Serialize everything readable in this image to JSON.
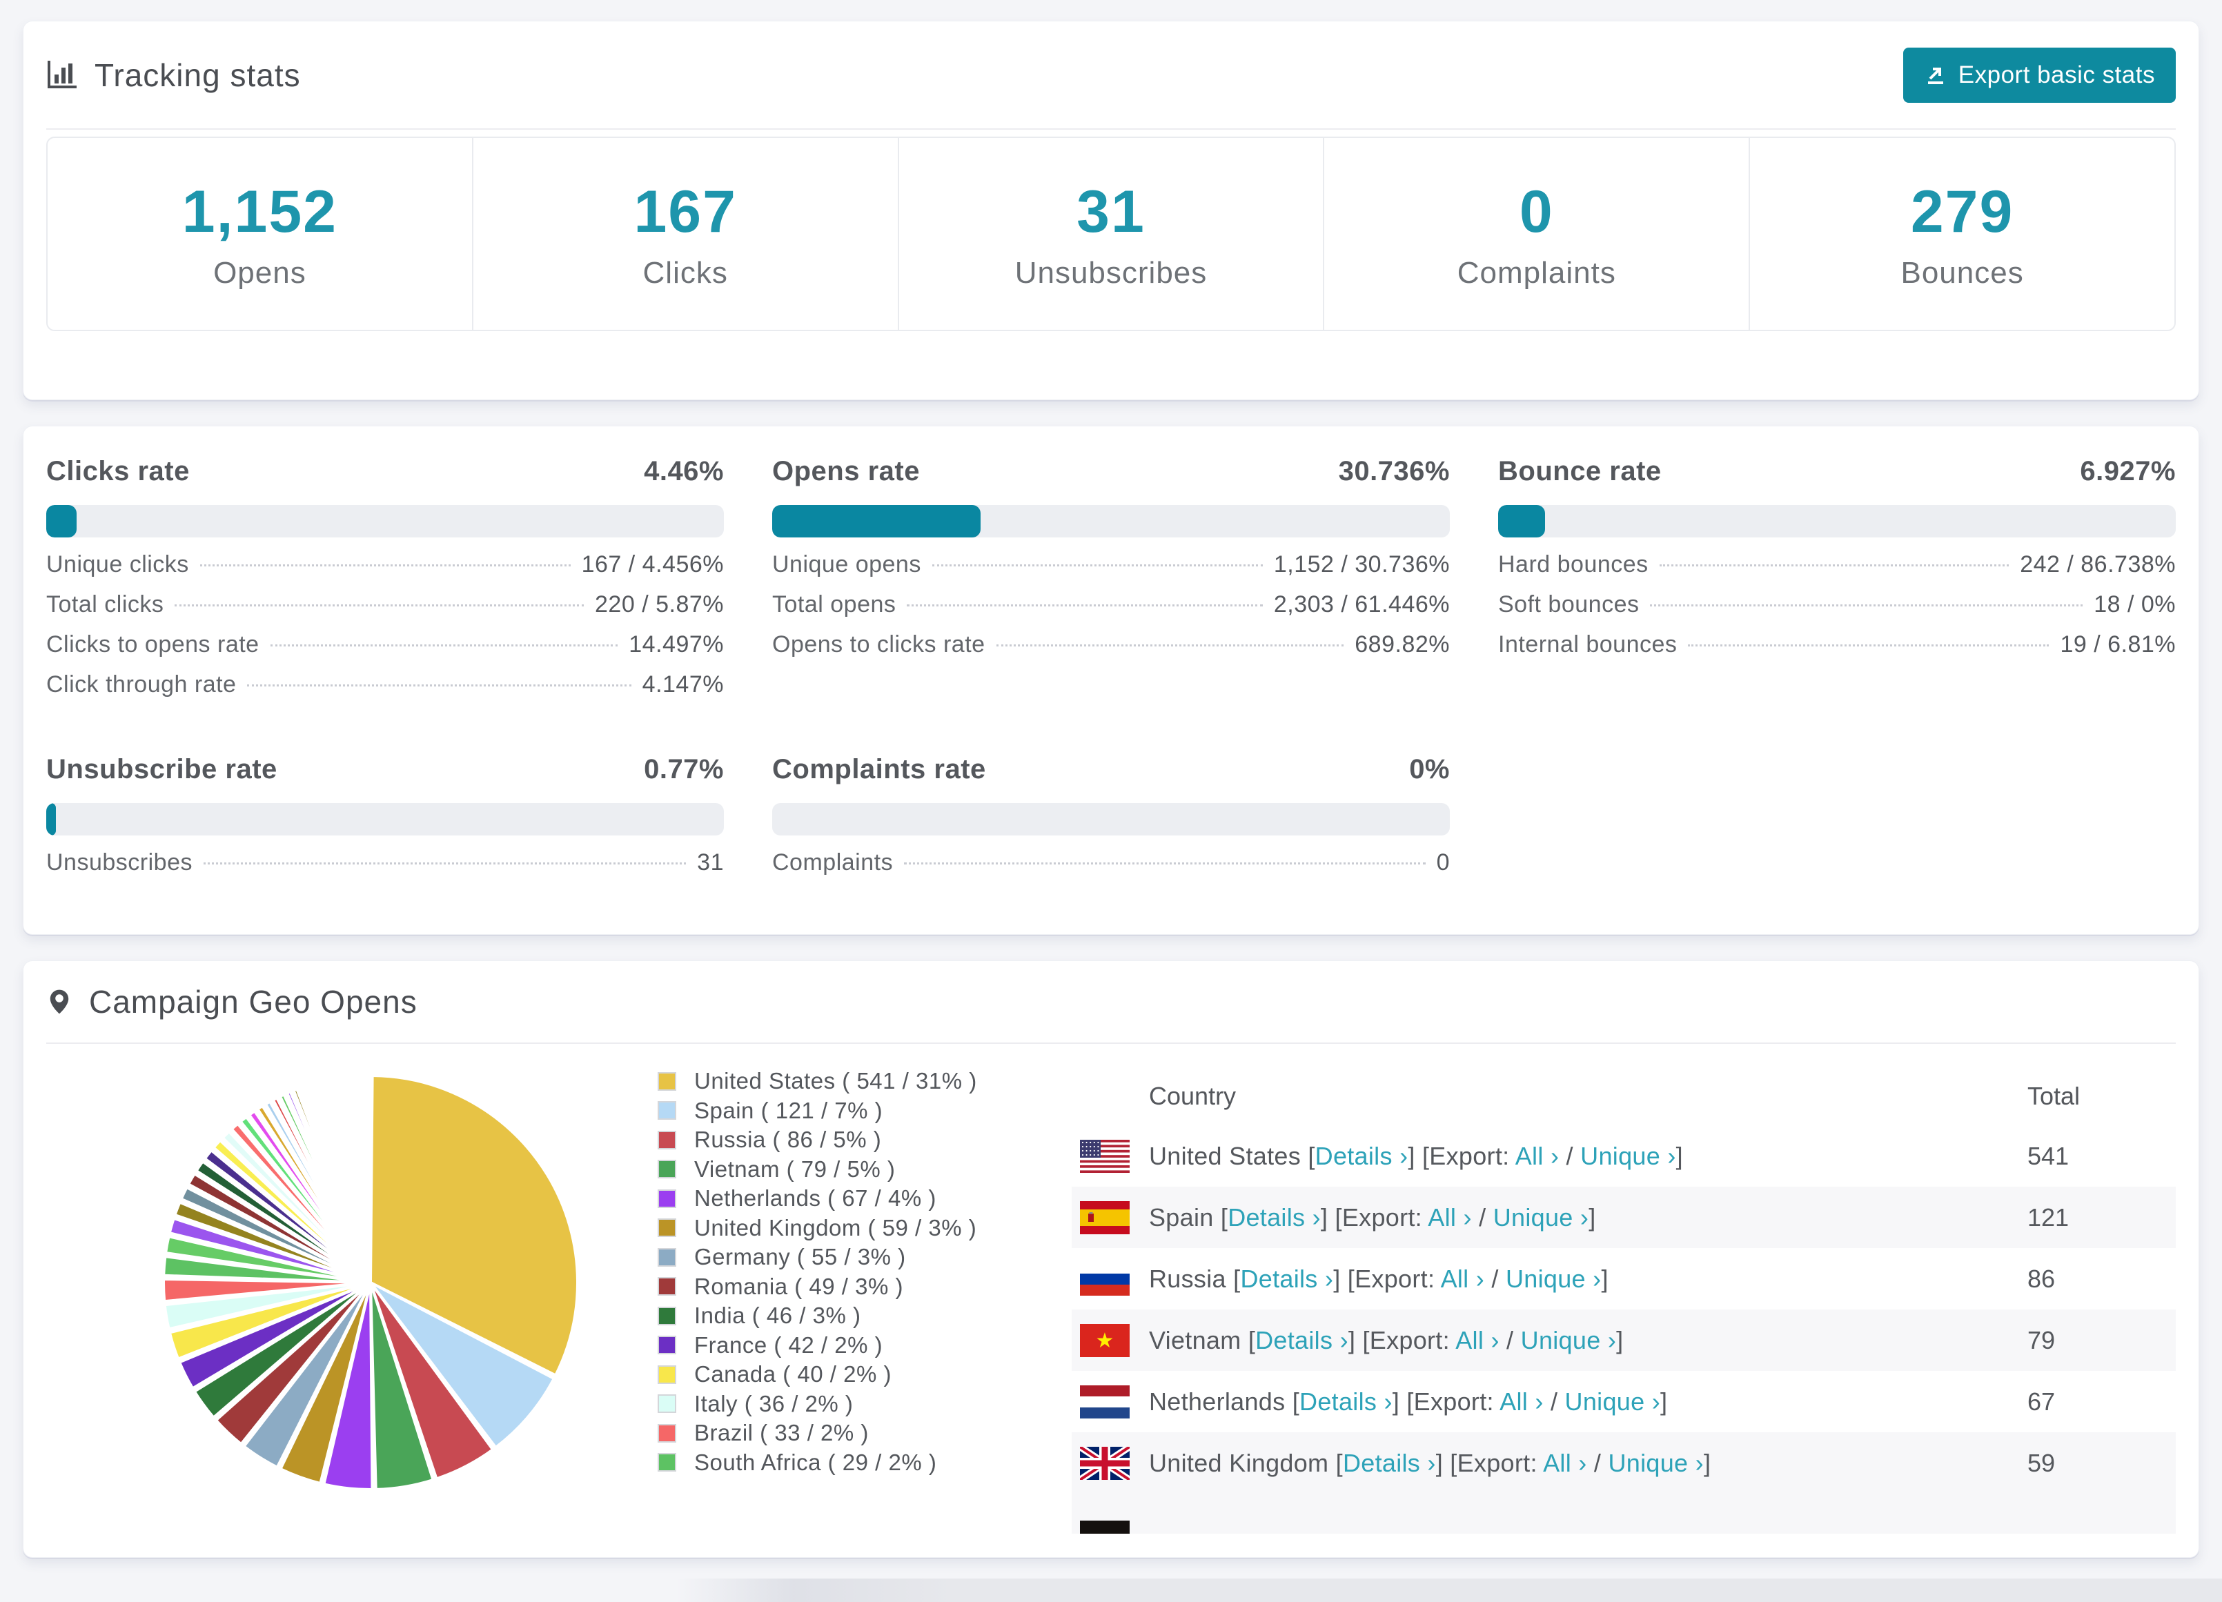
{
  "colors": {
    "accent_number": "#1e95ac",
    "button": "#0e8a9f",
    "progress_fill": "#0a87a1",
    "progress_track": "#eceef2",
    "link": "#2da2b8"
  },
  "tracking": {
    "title": "Tracking stats",
    "export_label": "Export basic stats",
    "stats": [
      {
        "value": "1,152",
        "label": "Opens"
      },
      {
        "value": "167",
        "label": "Clicks"
      },
      {
        "value": "31",
        "label": "Unsubscribes"
      },
      {
        "value": "0",
        "label": "Complaints"
      },
      {
        "value": "279",
        "label": "Bounces"
      }
    ]
  },
  "rates": [
    {
      "title": "Clicks rate",
      "value": "4.46%",
      "percent": 4.46,
      "rows": [
        {
          "label": "Unique clicks",
          "value": "167 / 4.456%"
        },
        {
          "label": "Total clicks",
          "value": "220 / 5.87%"
        },
        {
          "label": "Clicks to opens rate",
          "value": "14.497%"
        },
        {
          "label": "Click through rate",
          "value": "4.147%"
        }
      ]
    },
    {
      "title": "Opens rate",
      "value": "30.736%",
      "percent": 30.736,
      "rows": [
        {
          "label": "Unique opens",
          "value": "1,152 / 30.736%"
        },
        {
          "label": "Total opens",
          "value": "2,303 / 61.446%"
        },
        {
          "label": "Opens to clicks rate",
          "value": "689.82%"
        }
      ]
    },
    {
      "title": "Bounce rate",
      "value": "6.927%",
      "percent": 6.927,
      "rows": [
        {
          "label": "Hard bounces",
          "value": "242 / 86.738%"
        },
        {
          "label": "Soft bounces",
          "value": "18 / 0%"
        },
        {
          "label": "Internal bounces",
          "value": "19 / 6.81%"
        }
      ]
    },
    {
      "title": "Unsubscribe rate",
      "value": "0.77%",
      "percent": 0.77,
      "rows": [
        {
          "label": "Unsubscribes",
          "value": "31"
        }
      ]
    },
    {
      "title": "Complaints rate",
      "value": "0%",
      "percent": 0,
      "rows": [
        {
          "label": "Complaints",
          "value": "0"
        }
      ]
    }
  ],
  "geo": {
    "title": "Campaign Geo Opens",
    "legend": [
      {
        "label": "United States ( 541 / 31% )",
        "color": "#e7c345"
      },
      {
        "label": "Spain ( 121 / 7% )",
        "color": "#b5d9f5"
      },
      {
        "label": "Russia ( 86 / 5% )",
        "color": "#c84a52"
      },
      {
        "label": "Vietnam ( 79 / 5% )",
        "color": "#4aa558"
      },
      {
        "label": "Netherlands ( 67 / 4% )",
        "color": "#9b3ff0"
      },
      {
        "label": "United Kingdom ( 59 / 3% )",
        "color": "#bb9426"
      },
      {
        "label": "Germany ( 55 / 3% )",
        "color": "#8cabc4"
      },
      {
        "label": "Romania ( 49 / 3% )",
        "color": "#a03a3a"
      },
      {
        "label": "India ( 46 / 3% )",
        "color": "#2f7a3b"
      },
      {
        "label": "France ( 42 / 2% )",
        "color": "#6c2fc4"
      },
      {
        "label": "Canada ( 40 / 2% )",
        "color": "#f8e74b"
      },
      {
        "label": "Italy ( 36 / 2% )",
        "color": "#dafdf6"
      },
      {
        "label": "Brazil ( 33 / 2% )",
        "color": "#f56767"
      },
      {
        "label": "South Africa ( 29 / 2% )",
        "color": "#5dc263"
      }
    ],
    "table": {
      "columns": [
        "Country",
        "Total"
      ],
      "links": {
        "bracket_open": " [",
        "details": "Details ›",
        "export_open": "] [Export: ",
        "all": "All ›",
        "slash": " / ",
        "unique": "Unique ›",
        "bracket_close": "]"
      },
      "rows": [
        {
          "flag": "us",
          "name": "United States",
          "total": "541"
        },
        {
          "flag": "es",
          "name": "Spain",
          "total": "121"
        },
        {
          "flag": "ru",
          "name": "Russia",
          "total": "86"
        },
        {
          "flag": "vn",
          "name": "Vietnam",
          "total": "79"
        },
        {
          "flag": "nl",
          "name": "Netherlands",
          "total": "67"
        },
        {
          "flag": "gb",
          "name": "United Kingdom",
          "total": "59"
        }
      ]
    }
  },
  "chart_data": {
    "type": "pie",
    "title": "Campaign Geo Opens",
    "legend_position": "right",
    "series": [
      {
        "name": "United States",
        "value": 541,
        "pct": 31,
        "color": "#e7c345"
      },
      {
        "name": "Spain",
        "value": 121,
        "pct": 7,
        "color": "#b5d9f5"
      },
      {
        "name": "Russia",
        "value": 86,
        "pct": 5,
        "color": "#c84a52"
      },
      {
        "name": "Vietnam",
        "value": 79,
        "pct": 5,
        "color": "#4aa558"
      },
      {
        "name": "Netherlands",
        "value": 67,
        "pct": 4,
        "color": "#9b3ff0"
      },
      {
        "name": "United Kingdom",
        "value": 59,
        "pct": 3,
        "color": "#bb9426"
      },
      {
        "name": "Germany",
        "value": 55,
        "pct": 3,
        "color": "#8cabc4"
      },
      {
        "name": "Romania",
        "value": 49,
        "pct": 3,
        "color": "#a03a3a"
      },
      {
        "name": "India",
        "value": 46,
        "pct": 3,
        "color": "#2f7a3b"
      },
      {
        "name": "France",
        "value": 42,
        "pct": 2,
        "color": "#6c2fc4"
      },
      {
        "name": "Canada",
        "value": 40,
        "pct": 2,
        "color": "#f8e74b"
      },
      {
        "name": "Italy",
        "value": 36,
        "pct": 2,
        "color": "#dafdf6"
      },
      {
        "name": "Brazil",
        "value": 33,
        "pct": 2,
        "color": "#f56767"
      },
      {
        "name": "South Africa",
        "value": 29,
        "pct": 2,
        "color": "#5dc263"
      }
    ],
    "other_slices": {
      "note": "long tail of unlabeled small country slices",
      "values": [
        26,
        24,
        22,
        21,
        20,
        19,
        18,
        17,
        16,
        15,
        14,
        13,
        12,
        11,
        10,
        10,
        9,
        9,
        8,
        8,
        7,
        7,
        6,
        6,
        5,
        5,
        4,
        4,
        4,
        3,
        3,
        3,
        3,
        2,
        2,
        2,
        2,
        2,
        1,
        1,
        1,
        1,
        1,
        1,
        1,
        1
      ],
      "colors_cycle": [
        "#66cc66",
        "#9b55ee",
        "#94831f",
        "#71909e",
        "#8e3434",
        "#235f36",
        "#4a2f8e",
        "#f9ee52",
        "#e2fcf8",
        "#f96d6d",
        "#62e07a",
        "#e24bee",
        "#d9a82f",
        "#a9cfee",
        "#dd4848"
      ]
    }
  }
}
